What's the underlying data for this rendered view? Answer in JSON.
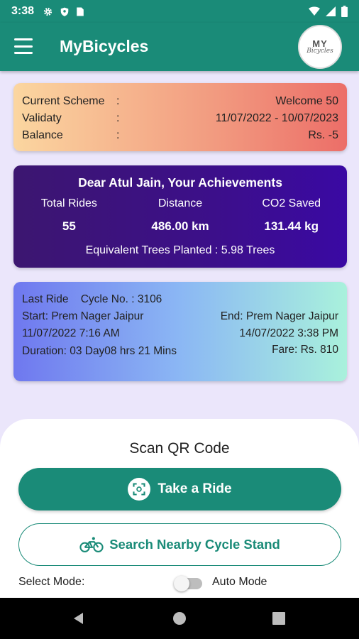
{
  "status_bar": {
    "time": "3:38"
  },
  "app_bar": {
    "title": "MyBicycles",
    "logo_line1": "MY",
    "logo_line2": "Bicycles"
  },
  "scheme": {
    "current_scheme_label": "Current Scheme",
    "current_scheme_value": "Welcome 50",
    "validity_label": "Validaty",
    "validity_value": "11/07/2022 - 10/07/2023",
    "balance_label": "Balance",
    "balance_value": "Rs. -5",
    "colon": ":"
  },
  "achievements": {
    "title": "Dear Atul Jain, Your Achievements",
    "total_rides_label": "Total Rides",
    "total_rides_value": "55",
    "distance_label": "Distance",
    "distance_value": "486.00 km",
    "co2_label": "CO2 Saved",
    "co2_value": "131.44 kg",
    "trees_text": "Equivalent Trees Planted :  5.98 Trees"
  },
  "last_ride": {
    "title": "Last Ride",
    "cycle_no": "Cycle No. : 3106",
    "start": "Start: Prem Nager Jaipur",
    "end": "End: Prem Nager Jaipur",
    "start_time": "11/07/2022 7:16 AM",
    "end_time": "14/07/2022 3:38 PM",
    "duration": "Duration: 03 Day08 hrs 21 Mins",
    "fare": "Fare: Rs. 810"
  },
  "actions": {
    "scan_title": "Scan QR Code",
    "take_ride_label": "Take a Ride",
    "search_label": "Search Nearby Cycle Stand",
    "select_mode_label": "Select Mode:",
    "auto_mode_label": "Auto Mode"
  },
  "colors": {
    "primary": "#1a8b78",
    "achievements_bg": "#3c0f8a"
  }
}
